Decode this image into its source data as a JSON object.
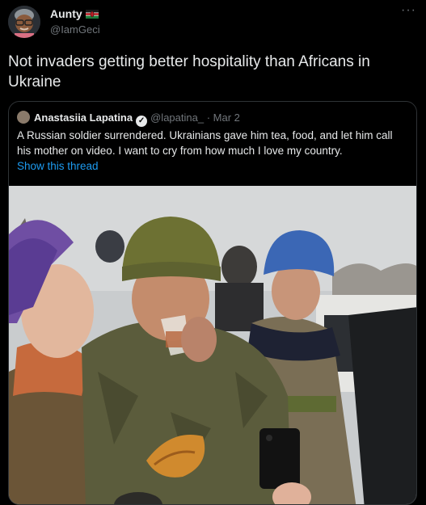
{
  "author": {
    "name": "Aunty",
    "handle": "@IamGeci",
    "flag_icon": "kenya-flag-icon"
  },
  "more_icon": "more-dots-icon",
  "tweet_text": "Not invaders getting better hospitality than Africans in Ukraine",
  "quoted": {
    "name": "Anastasiia Lapatina",
    "handle": "@lapatina_",
    "separator": "·",
    "date": "Mar 2",
    "text": "A Russian soldier surrendered. Ukrainians gave him tea, food, and let him call his mother on video. I want to cry from how much I love my country.",
    "show_thread": "Show this thread",
    "verified_icon": "verified-badge-icon"
  },
  "colors": {
    "background": "#000000",
    "text": "#e7e9ea",
    "secondary": "#71767b",
    "link": "#1d9bf0",
    "border": "#2f3336"
  }
}
